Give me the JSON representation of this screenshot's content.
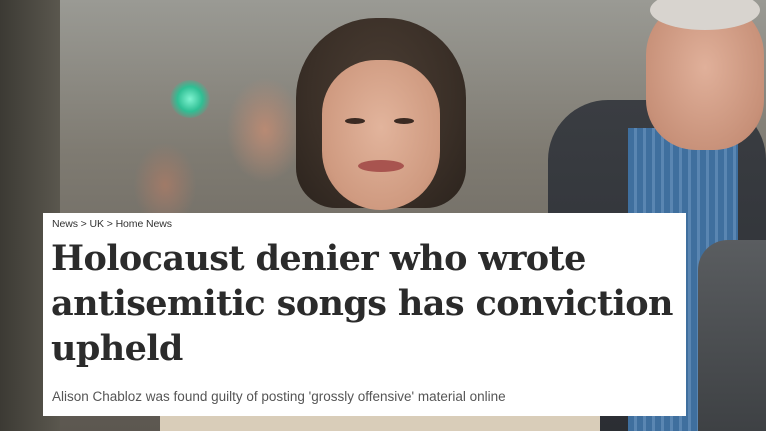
{
  "article": {
    "breadcrumb": "News > UK > Home News",
    "headline": "Holocaust denier who wrote antisemitic songs has conviction upheld",
    "standfirst": "Alison Chabloz was found guilty of posting 'grossly offensive' material online"
  },
  "colors": {
    "card_background": "#ffffff",
    "headline_text": "#2b2b2b",
    "standfirst_text": "#555555"
  }
}
